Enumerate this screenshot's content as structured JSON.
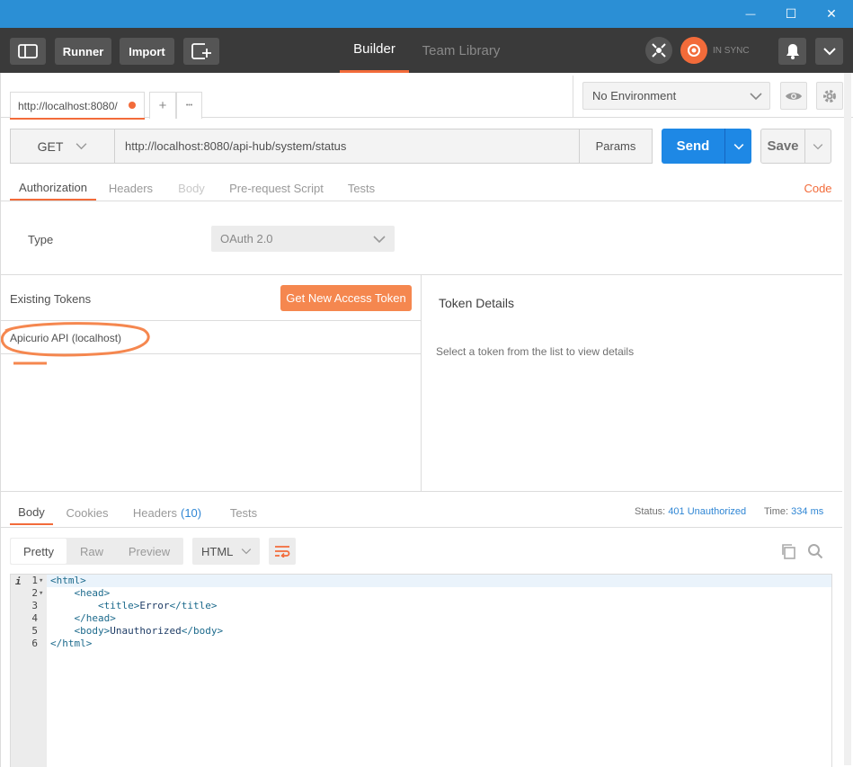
{
  "window": {
    "minimize_glyph": "—",
    "maximize_glyph": "☐",
    "close_glyph": "✕"
  },
  "header": {
    "runner_label": "Runner",
    "import_label": "Import",
    "tabs": [
      "Builder",
      "Team Library"
    ],
    "sync_label": "IN SYNC",
    "accent": "#f26b3a"
  },
  "request_tab": {
    "title": "http://localhost:8080/",
    "add_glyph": "+",
    "more_glyph": "•••"
  },
  "environment": {
    "selected": "No Environment"
  },
  "request": {
    "method": "GET",
    "url": "http://localhost:8080/api-hub/system/status",
    "params_label": "Params",
    "send_label": "Send",
    "save_label": "Save"
  },
  "request_tabs": [
    "Authorization",
    "Headers",
    "Body",
    "Pre-request Script",
    "Tests"
  ],
  "code_link": "Code",
  "auth": {
    "type_label": "Type",
    "type_value": "OAuth 2.0",
    "existing_tokens_label": "Existing Tokens",
    "get_token_label": "Get New Access Token",
    "tokens": [
      "Apicurio API (localhost)"
    ],
    "token_details_title": "Token Details",
    "token_details_hint": "Select a token from the list to view details"
  },
  "response": {
    "tabs": [
      "Body",
      "Cookies",
      "Headers",
      "Tests"
    ],
    "headers_count": "(10)",
    "status_label": "Status:",
    "status_value": "401 Unauthorized",
    "time_label": "Time:",
    "time_value": "334 ms",
    "view_modes": [
      "Pretty",
      "Raw",
      "Preview"
    ],
    "format": "HTML",
    "code_lines": [
      {
        "num": "1",
        "fold": "▾",
        "html": "&lt;html&gt;"
      },
      {
        "num": "2",
        "fold": "▾",
        "html": "    &lt;head&gt;"
      },
      {
        "num": "3",
        "fold": "",
        "html": "        &lt;title&gt;Error&lt;/title&gt;"
      },
      {
        "num": "4",
        "fold": "",
        "html": "    &lt;/head&gt;"
      },
      {
        "num": "5",
        "fold": "",
        "html": "    &lt;body&gt;Unauthorized&lt;/body&gt;"
      },
      {
        "num": "6",
        "fold": "",
        "html": "&lt;/html&gt;"
      }
    ],
    "info_glyph": "i"
  },
  "colors": {
    "titlebar": "#2b8fd5",
    "send_blue": "#1e88e5",
    "orange": "#f26b3a",
    "link_blue": "#2f86d4"
  }
}
